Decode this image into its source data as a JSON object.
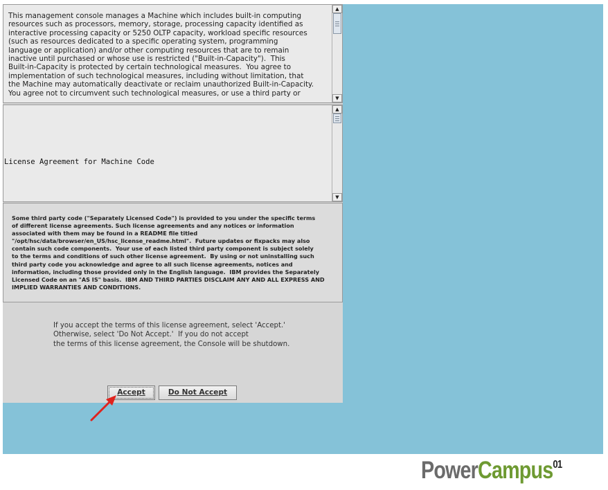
{
  "license_text": "This management console manages a Machine which includes built-in computing\nresources such as processors, memory, storage, processing capacity identified as\ninteractive processing capacity or 5250 OLTP capacity, workload specific resources\n(such as resources dedicated to a specific operating system, programming\nlanguage or application) and/or other computing resources that are to remain\ninactive until purchased or whose use is restricted (\"Built-in-Capacity\").  This\nBuilt-in-Capacity is protected by certain technological measures.  You agree to\nimplementation of such technological measures, including without limitation, that\nthe Machine may automatically deactivate or reclaim unauthorized Built-in-Capacity.\nYou agree not to circumvent such technological measures, or use a third party or",
  "middle_label": "License Agreement for Machine Code",
  "third_party_text": "Some third party code (\"Separately Licensed Code\") is provided to you under the specific terms\nof different license agreements. Such license agreements and any notices or information\nassociated with them may be found in a README file titled\n\"/opt/hsc/data/browser/en_US/hsc_license_readme.html\".  Future updates or fixpacks may also\ncontain such code components.  Your use of each listed third party component is subject solely\nto the terms and conditions of such other license agreement.  By using or not uninstalling such\nthird party code you acknowledge and agree to all such license agreements, notices and\ninformation, including those provided only in the English language.  IBM provides the Separately\nLicensed Code on an \"AS IS\" basis.  IBM AND THIRD PARTIES DISCLAIM ANY AND ALL EXPRESS AND\nIMPLIED WARRANTIES AND CONDITIONS.",
  "accept_instructions": "If you accept the terms of this license agreement, select 'Accept.'\nOtherwise, select 'Do Not Accept.'  If you do not accept\nthe terms of this license agreement, the Console will be shutdown.",
  "buttons": {
    "accept": "Accept",
    "decline": "Do Not Accept"
  },
  "logo": {
    "part1": "Power",
    "part2": "Campus",
    "sup": "01"
  },
  "colors": {
    "desktop": "#85c2d8",
    "panel": "#d6d6d6",
    "arrow": "#e0231d",
    "logo_gray": "#6b6b6b",
    "logo_green": "#6e9a32"
  }
}
